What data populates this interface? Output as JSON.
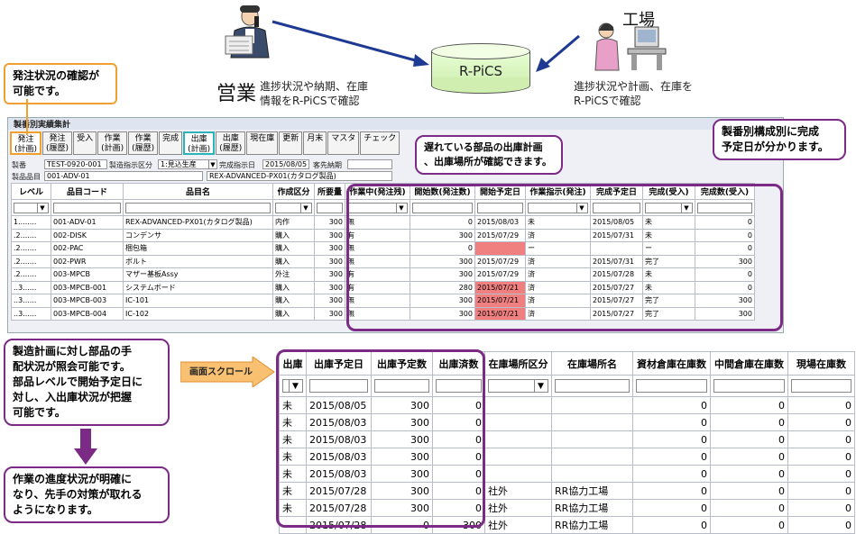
{
  "top": {
    "eigyo_label": "営業",
    "eigyo_text": [
      "進捗状況や納期、在庫",
      "情報をR-PiCSで確認"
    ],
    "kojo_label": "工場",
    "kojo_text": [
      "進捗状況や計画、在庫を",
      "R-PiCSで確認"
    ],
    "db_label": "R-PiCS"
  },
  "callouts": {
    "order_check": [
      "発注状況の確認が",
      "可能です。"
    ],
    "delay_parts": [
      "遅れている部品の出庫計画",
      "、出庫場所が確認できます。"
    ],
    "completion": [
      "製番別構成別に完成",
      "予定日が分かります。"
    ],
    "plan_left": [
      "製造計画に対し部品の手",
      "配状況が照会可能です。",
      "部品レベルで開始予定日に",
      "対し、入出庫状況が把握",
      "可能です。"
    ],
    "progress": [
      "作業の進度状況が明確に",
      "なり、先手の対策が取れる",
      "ようになります。"
    ],
    "scroll": "画面スクロール"
  },
  "app": {
    "title": "製番別実績集計",
    "tabs": [
      {
        "l1": "発注",
        "l2": "(計画)"
      },
      {
        "l1": "発注",
        "l2": "(履歴)"
      },
      {
        "l1": "受入",
        "l2": ""
      },
      {
        "l1": "作業",
        "l2": "(計画)"
      },
      {
        "l1": "作業",
        "l2": "(履歴)"
      },
      {
        "l1": "完成",
        "l2": ""
      },
      {
        "l1": "出庫",
        "l2": "(計画)"
      },
      {
        "l1": "出庫",
        "l2": "(履歴)"
      },
      {
        "l1": "現在庫",
        "l2": ""
      },
      {
        "l1": "更新",
        "l2": ""
      },
      {
        "l1": "月末",
        "l2": ""
      },
      {
        "l1": "マスタ",
        "l2": ""
      },
      {
        "l1": "チェック",
        "l2": ""
      }
    ],
    "seiban_label": "製番",
    "seiban_value": "TEST-0920-001",
    "shiji_label": "製造指示区分",
    "shiji_value": "1:見込生産",
    "kansei_label": "完成指示日",
    "kansei_value": "2015/08/05",
    "kyaku_label": "客先納期",
    "hinmoku_label": "製品品目",
    "hinmoku_code": "001-ADV-01",
    "hinmoku_name": "REX-ADVANCED-PX01(カタログ製品)",
    "columns": [
      "レベル",
      "品目コード",
      "品目名",
      "作成区分",
      "所要量",
      "作業中(発注残)",
      "開始数(発注数)",
      "開始予定日",
      "作業指示(発注)",
      "完成予定日",
      "完成(受入)",
      "完成数(受入)"
    ],
    "rows": [
      [
        "1........",
        "001-ADV-01",
        "REX-ADVANCED-PX01(カタログ製品)",
        "内作",
        "300",
        "無",
        "0",
        "2015/08/03",
        "未",
        "2015/08/05",
        "未",
        "0"
      ],
      [
        ".2.......",
        "002-DISK",
        "コンデンサ",
        "購入",
        "300",
        "有",
        "300",
        "2015/07/29",
        "済",
        "2015/07/31",
        "未",
        "0"
      ],
      [
        ".2.......",
        "002-PAC",
        "梱包箱",
        "購入",
        "300",
        "無",
        "0",
        "",
        "ー",
        "",
        "ー",
        "0"
      ],
      [
        ".2.......",
        "002-PWR",
        "ボルト",
        "購入",
        "300",
        "無",
        "300",
        "2015/07/29",
        "済",
        "2015/07/31",
        "完了",
        "300"
      ],
      [
        ".2.......",
        "003-MPCB",
        "マザー基板Assy",
        "外注",
        "300",
        "有",
        "300",
        "2015/07/29",
        "済",
        "2015/07/28",
        "未",
        "0"
      ],
      [
        "..3......",
        "003-MPCB-001",
        "システムボード",
        "購入",
        "300",
        "有",
        "280",
        "2015/07/21",
        "済",
        "2015/07/27",
        "未",
        "0"
      ],
      [
        "..3......",
        "003-MPCB-003",
        "IC-101",
        "購入",
        "300",
        "無",
        "300",
        "2015/07/21",
        "済",
        "2015/07/27",
        "完了",
        "300"
      ],
      [
        "..3......",
        "003-MPCB-004",
        "IC-102",
        "購入",
        "300",
        "無",
        "300",
        "2015/07/21",
        "済",
        "2015/07/27",
        "完了",
        "300"
      ]
    ],
    "red_cells": [
      [
        2,
        7
      ],
      [
        5,
        7
      ],
      [
        6,
        7
      ],
      [
        7,
        7
      ]
    ]
  },
  "scrolled": {
    "columns": [
      "出庫",
      "出庫予定日",
      "出庫予定数",
      "出庫済数",
      "在庫場所区分",
      "在庫場所名",
      "資材倉庫在庫数",
      "中間倉庫在庫数",
      "現場在庫数"
    ],
    "rows": [
      [
        "未",
        "2015/08/05",
        "300",
        "0",
        "",
        "",
        "0",
        "0",
        "0"
      ],
      [
        "未",
        "2015/08/03",
        "300",
        "0",
        "",
        "",
        "0",
        "0",
        "0"
      ],
      [
        "未",
        "2015/08/03",
        "300",
        "0",
        "",
        "",
        "0",
        "0",
        "0"
      ],
      [
        "未",
        "2015/08/03",
        "300",
        "0",
        "",
        "",
        "0",
        "0",
        "0"
      ],
      [
        "未",
        "2015/08/03",
        "300",
        "0",
        "",
        "",
        "0",
        "0",
        "0"
      ],
      [
        "未",
        "2015/07/28",
        "300",
        "0",
        "社外",
        "RR協力工場",
        "0",
        "0",
        "0"
      ],
      [
        "未",
        "2015/07/28",
        "300",
        "0",
        "社外",
        "RR協力工場",
        "0",
        "0",
        "0"
      ],
      [
        "",
        "2015/07/28",
        "0",
        "300",
        "社外",
        "RR協力工場",
        "0",
        "0",
        "0"
      ]
    ]
  },
  "colors": {
    "orange": "#f0a030",
    "purple": "#7b2a86",
    "teal": "#2ab3b8",
    "late": "#f08080",
    "navy": "#1f3a93"
  }
}
